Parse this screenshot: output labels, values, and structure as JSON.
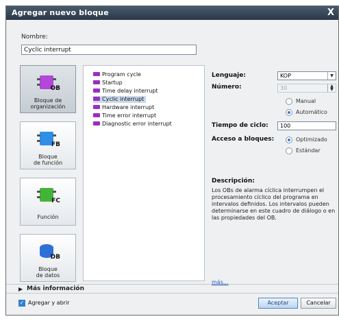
{
  "dialog": {
    "title": "Agregar nuevo bloque",
    "close": "X"
  },
  "name_field": {
    "label": "Nombre:",
    "value": "Cyclic interrupt"
  },
  "block_types": [
    {
      "label_line1": "Bloque de",
      "label_line2": "organización",
      "code": "OB",
      "color": "#b347d9"
    },
    {
      "label_line1": "Bloque",
      "label_line2": "de función",
      "code": "FB",
      "color": "#2f8fe8"
    },
    {
      "label_line1": "Función",
      "label_line2": "",
      "code": "FC",
      "color": "#43b43a"
    },
    {
      "label_line1": "Bloque",
      "label_line2": "de datos",
      "code": "DB",
      "color": "#2f6fd8"
    }
  ],
  "ob_list": [
    "Program cycle",
    "Startup",
    "Time delay interrupt",
    "Cyclic interrupt",
    "Hardware interrupt",
    "Time error interrupt",
    "Diagnostic error interrupt"
  ],
  "properties": {
    "language_label": "Lenguaje:",
    "language_value": "KOP",
    "number_label": "Número:",
    "number_value": "30",
    "manual_label": "Manual",
    "auto_label": "Automático",
    "cycle_label": "Tiempo de ciclo:",
    "cycle_value": "100",
    "access_label": "Acceso a bloques:",
    "optimized_label": "Optimizado",
    "standard_label": "Estándar"
  },
  "description": {
    "label": "Descripción:",
    "text": "Los OBs de alarma cíclica interrumpen el procesamiento cíclico del programa en intervalos definidos. Los intervalos pueden determinarse en este cuadro de diálogo o en las propiedades del OB.",
    "more_link": "más..."
  },
  "more_info": "Más información",
  "footer": {
    "add_open": "Agregar y abrir",
    "accept": "Aceptar",
    "cancel": "Cancelar"
  }
}
